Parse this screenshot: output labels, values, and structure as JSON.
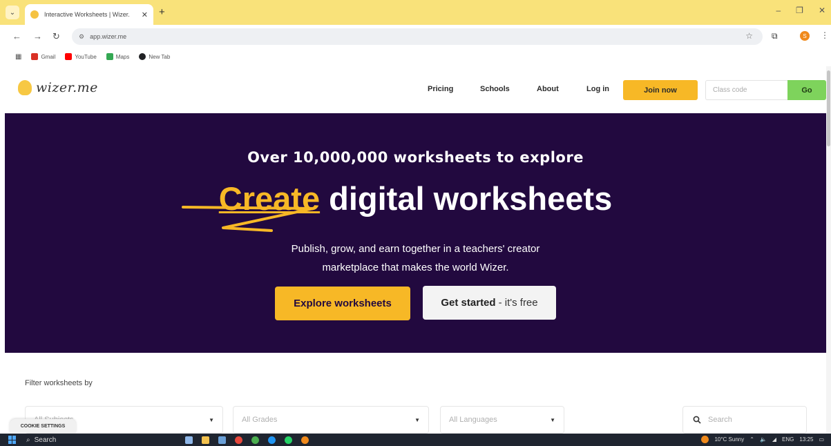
{
  "browser": {
    "tab_title": "Interactive Worksheets | Wizer.",
    "tab_close": "✕",
    "new_tab": "+",
    "url": "app.wizer.me",
    "profile_initial": "S",
    "window_controls": {
      "minimize": "–",
      "restore": "❐",
      "close": "✕"
    },
    "bookmarks": [
      {
        "label": "Gmail",
        "color": "#d93025"
      },
      {
        "label": "YouTube",
        "color": "#ff0000"
      },
      {
        "label": "Maps",
        "color": "#34a853"
      },
      {
        "label": "New Tab",
        "color": "#202124"
      }
    ]
  },
  "site": {
    "logo_text": "wizer.me",
    "nav": {
      "pricing": "Pricing",
      "schools": "Schools",
      "about": "About",
      "login": "Log in"
    },
    "join_label": "Join now",
    "class_code_placeholder": "Class code",
    "go_label": "Go"
  },
  "hero": {
    "tagline": "Over 10,000,000 worksheets to explore",
    "title_accent": "Create",
    "title_rest": " digital worksheets",
    "subtitle_line1": "Publish, grow, and earn together in a teachers' creator",
    "subtitle_line2": "marketplace that makes the world Wizer.",
    "explore_label": "Explore worksheets",
    "start_bold": "Get started",
    "start_rest": "- it's free"
  },
  "filters": {
    "label": "Filter worksheets by",
    "subjects": "All Subjects",
    "grades": "All Grades",
    "languages": "All Languages",
    "search_placeholder": "Search",
    "cookie_settings": "COOKIE SETTINGS"
  },
  "taskbar": {
    "search_label": "Search",
    "weather": "10°C Sunny",
    "language": "ENG",
    "time": "13:25"
  },
  "colors": {
    "accent": "#f7b826",
    "hero_bg": "#22093f",
    "go_green": "#7ed35c",
    "tab_bar": "#f9e27a"
  }
}
